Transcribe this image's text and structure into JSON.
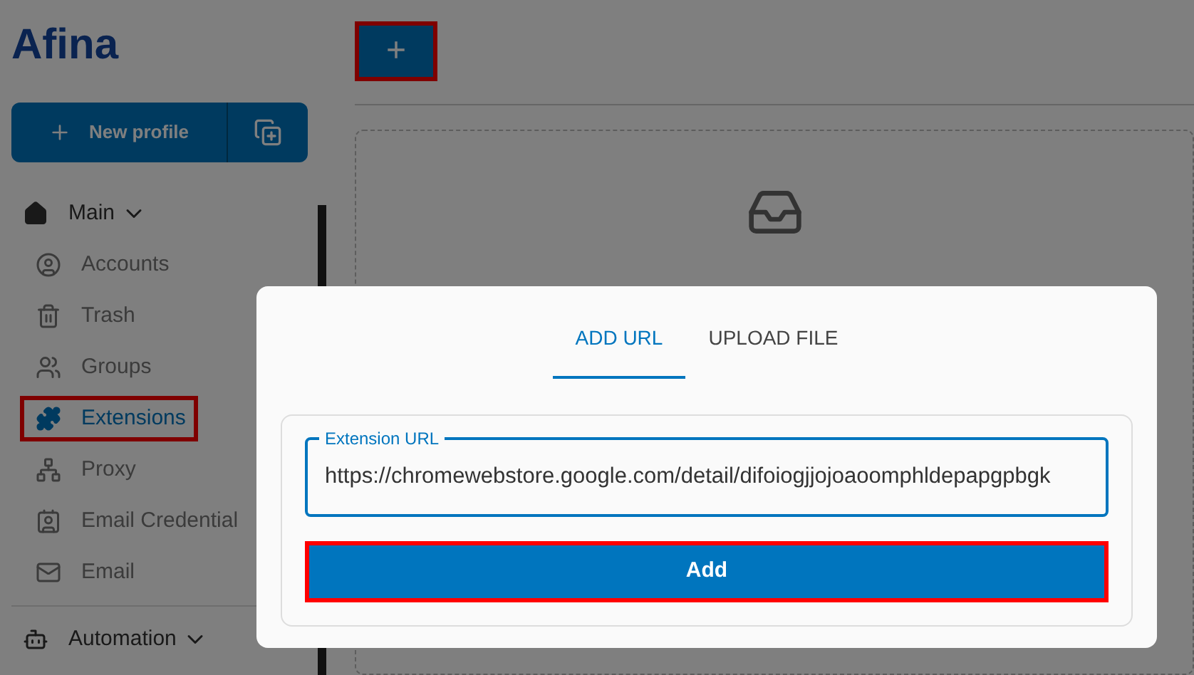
{
  "logo": "Afina",
  "new_profile": {
    "label": "New profile"
  },
  "nav": [
    {
      "label": "Main",
      "expanded": true,
      "children": [
        {
          "label": "Accounts",
          "selected": false,
          "highlighted": false
        },
        {
          "label": "Trash",
          "selected": false,
          "highlighted": false
        },
        {
          "label": "Groups",
          "selected": false,
          "highlighted": false
        },
        {
          "label": "Extensions",
          "selected": true,
          "highlighted": true
        },
        {
          "label": "Proxy",
          "selected": false,
          "highlighted": false
        },
        {
          "label": "Email Credential",
          "selected": false,
          "highlighted": false
        },
        {
          "label": "Email",
          "selected": false,
          "highlighted": false
        }
      ]
    },
    {
      "label": "Automation",
      "expanded": true
    }
  ],
  "toolbar": {
    "add_button": {
      "label": "+",
      "highlighted": true
    }
  },
  "dialog": {
    "tabs": [
      {
        "label": "ADD URL",
        "selected": true
      },
      {
        "label": "UPLOAD FILE",
        "selected": false
      }
    ],
    "field": {
      "label": "Extension URL",
      "value": "https://chromewebstore.google.com/detail/difoiogjjojoaoomphldepapgpbgk"
    },
    "add_button": {
      "label": "Add",
      "highlighted": true
    }
  }
}
